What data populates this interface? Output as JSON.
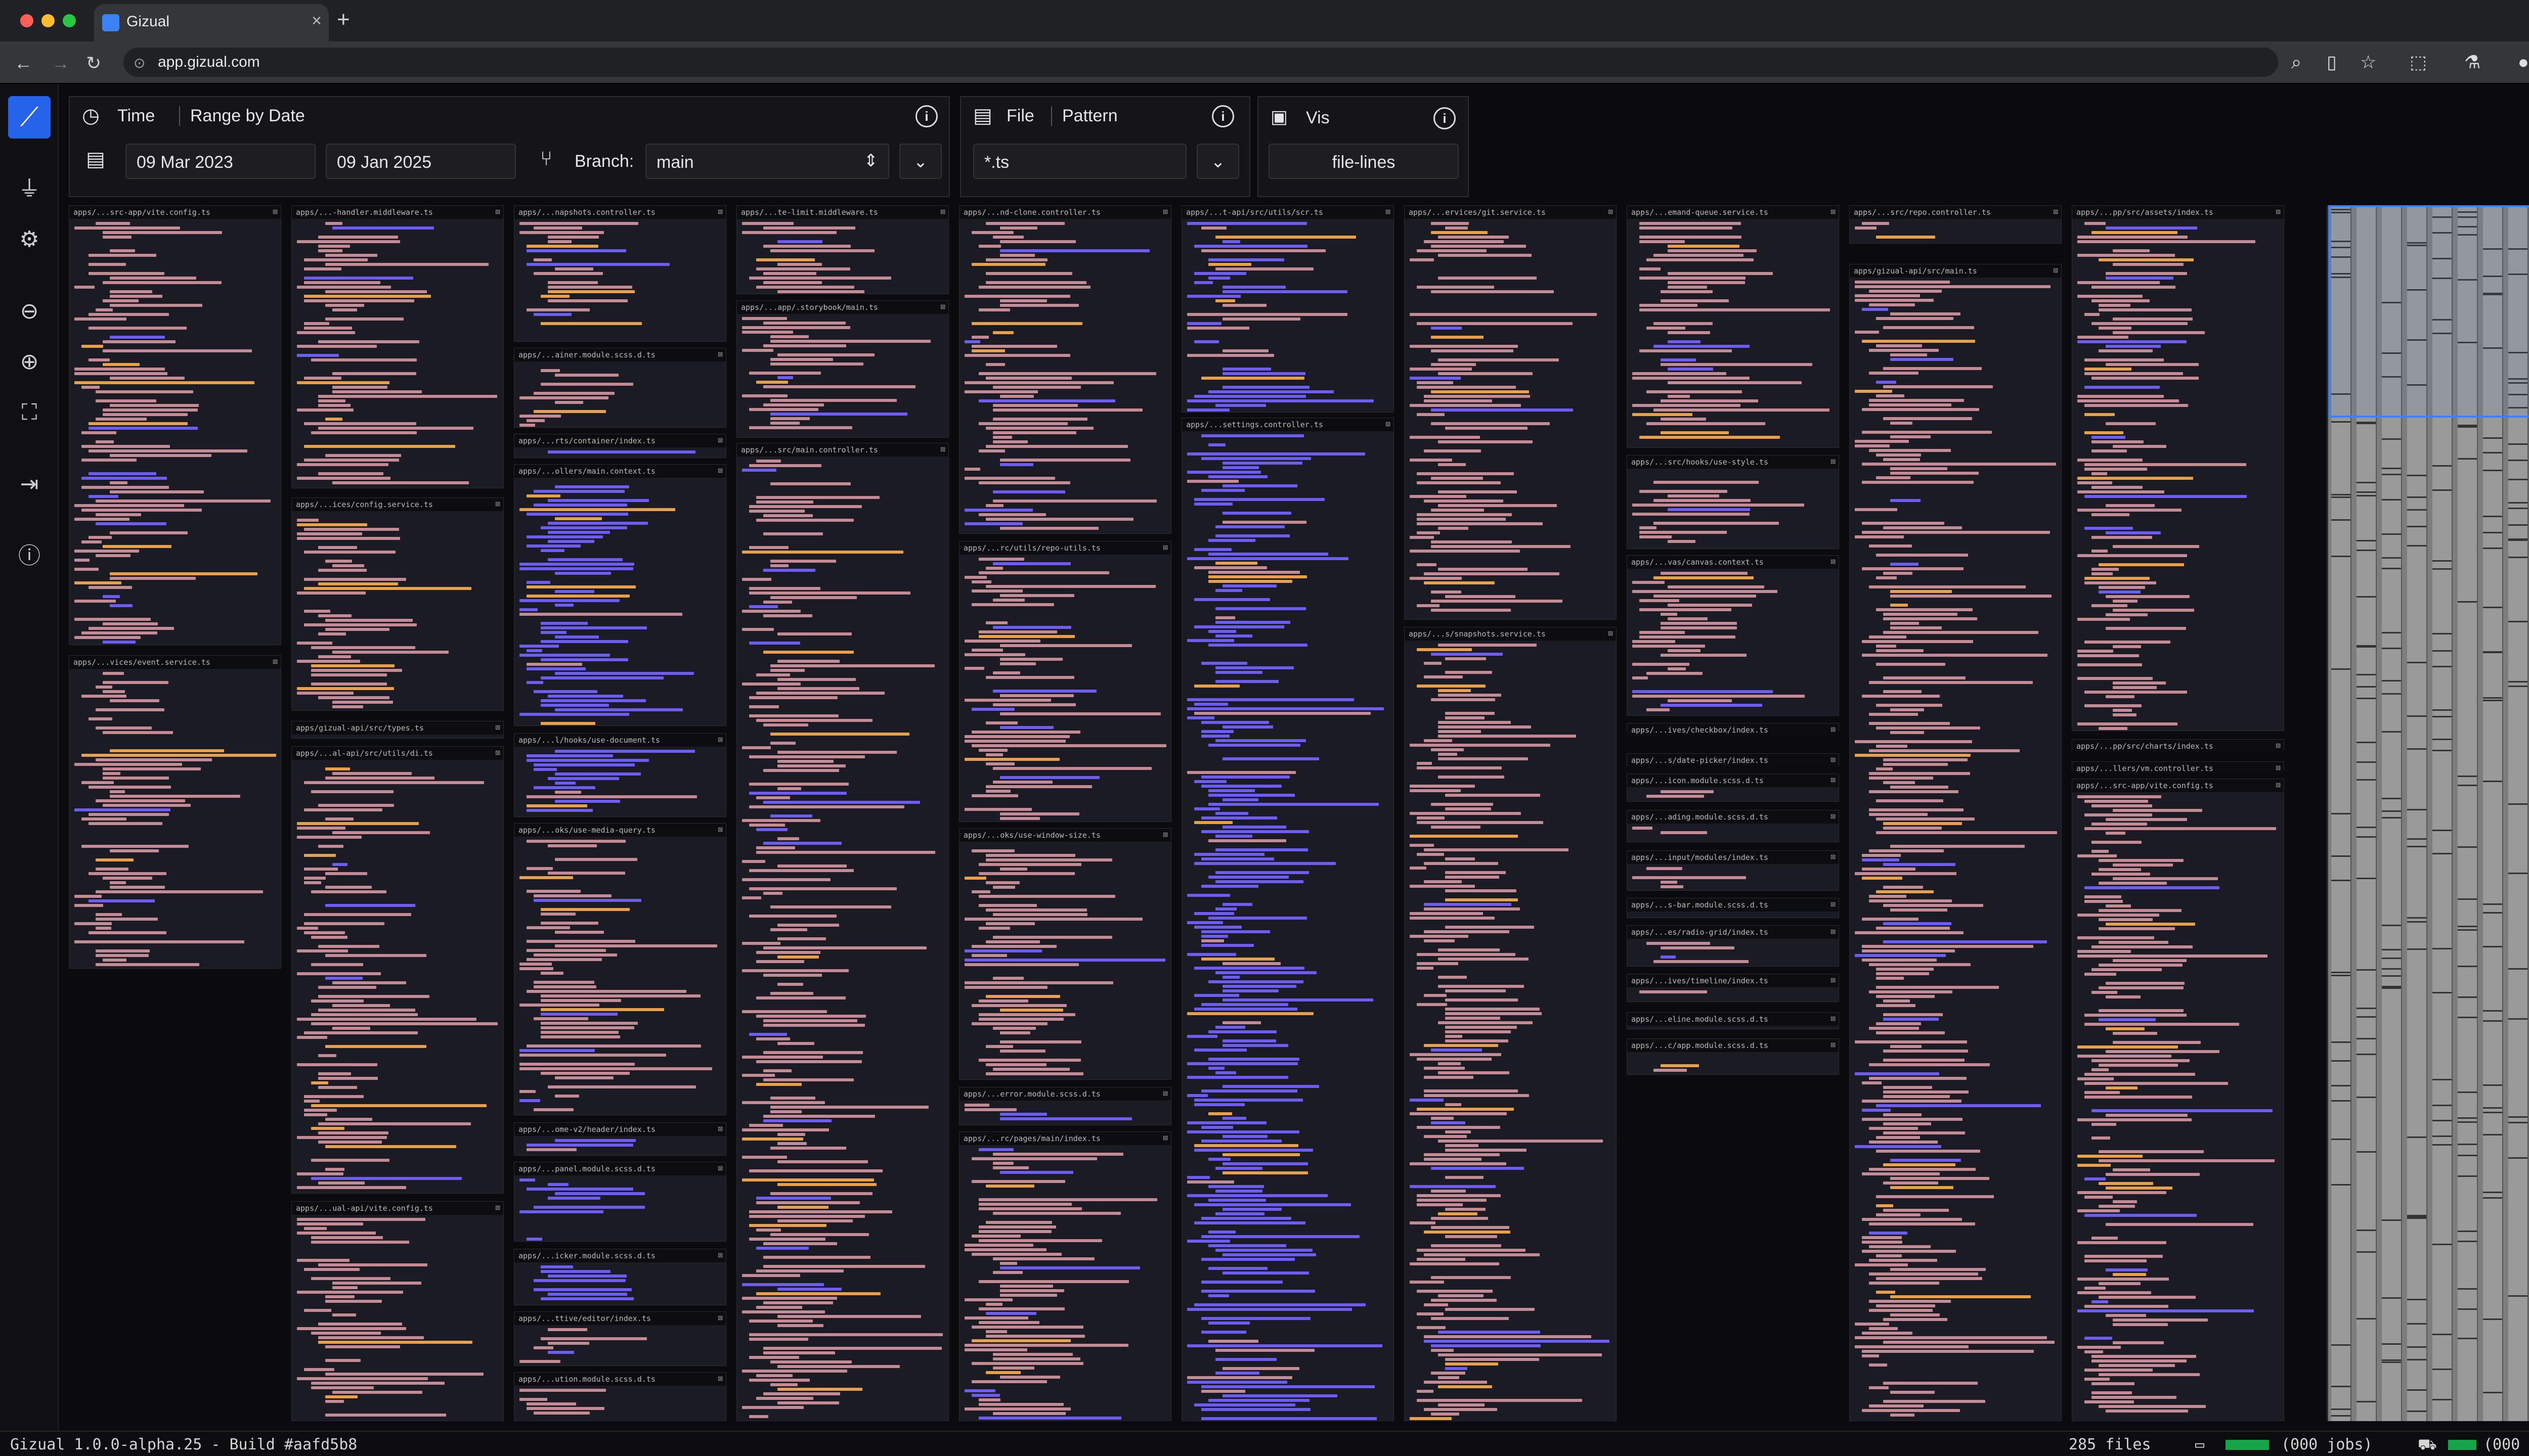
{
  "browser": {
    "tab_title": "Gizual",
    "url": "app.gizual.com"
  },
  "colors": {
    "accent": "#2563eb",
    "bg": "#0b0b0f",
    "card": "#1b1b23",
    "line_old": "#c48b94",
    "line_mid": "#6d5cf6",
    "line_new": "#e8a04a",
    "blue": "#3b3bf0"
  },
  "sidebar": {
    "items": [
      "filter-icon",
      "gear-icon",
      "zoom-out-icon",
      "zoom-in-icon",
      "fit-screen-icon",
      "export-icon",
      "info-icon"
    ]
  },
  "time_panel": {
    "label": "Time",
    "mode": "Range by Date",
    "start": "09 Mar 2023",
    "end": "09 Jan 2025",
    "branch_label": "Branch:",
    "branch": "main"
  },
  "file_panel": {
    "label": "File",
    "mode": "Pattern",
    "pattern": "*.ts"
  },
  "vis_panel": {
    "label": "Vis",
    "mode": "file-lines"
  },
  "files": [
    {
      "name": "apps/...src-app/vite.config.ts"
    },
    {
      "name": "apps/...vices/event.service.ts"
    },
    {
      "name": "apps/...-handler.middleware.ts"
    },
    {
      "name": "apps/...ices/config.service.ts"
    },
    {
      "name": "apps/gizual-api/src/types.ts"
    },
    {
      "name": "apps/...al-api/src/utils/di.ts"
    },
    {
      "name": "apps/...ual-api/vite.config.ts"
    },
    {
      "name": "apps/...napshots.controller.ts"
    },
    {
      "name": "apps/...ainer.module.scss.d.ts"
    },
    {
      "name": "apps/...rts/container/index.ts"
    },
    {
      "name": "apps/...ollers/main.context.ts"
    },
    {
      "name": "apps/...l/hooks/use-document.ts"
    },
    {
      "name": "apps/...oks/use-media-query.ts"
    },
    {
      "name": "apps/...ome-v2/header/index.ts"
    },
    {
      "name": "apps/...panel.module.scss.d.ts"
    },
    {
      "name": "apps/...icker.module.scss.d.ts"
    },
    {
      "name": "apps/...ttive/editor/index.ts"
    },
    {
      "name": "apps/...ution.module.scss.d.ts"
    },
    {
      "name": "apps/...te-limit.middleware.ts"
    },
    {
      "name": "apps/...app/.storybook/main.ts"
    },
    {
      "name": "apps/...src/main.controller.ts"
    },
    {
      "name": "apps/...nd-clone.controller.ts"
    },
    {
      "name": "apps/...rc/utils/repo-utils.ts"
    },
    {
      "name": "apps/...oks/use-window-size.ts"
    },
    {
      "name": "apps/...error.module.scss.d.ts"
    },
    {
      "name": "apps/...rc/pages/main/index.ts"
    },
    {
      "name": "apps/...t-api/src/utils/scr.ts"
    },
    {
      "name": "apps/...settings.controller.ts"
    },
    {
      "name": "apps/...ervices/git.service.ts"
    },
    {
      "name": "apps/...s/snapshots.service.ts"
    },
    {
      "name": "apps/...emand-queue.service.ts"
    },
    {
      "name": "apps/...src/hooks/use-style.ts"
    },
    {
      "name": "apps/...vas/canvas.context.ts"
    },
    {
      "name": "apps/...ives/checkbox/index.ts"
    },
    {
      "name": "apps/...s/date-picker/index.ts"
    },
    {
      "name": "apps/...icon.module.scss.d.ts"
    },
    {
      "name": "apps/...ading.module.scss.d.ts"
    },
    {
      "name": "apps/...input/modules/index.ts"
    },
    {
      "name": "apps/...s-bar.module.scss.d.ts"
    },
    {
      "name": "apps/...es/radio-grid/index.ts"
    },
    {
      "name": "apps/...ives/timeline/index.ts"
    },
    {
      "name": "apps/...eline.module.scss.d.ts"
    },
    {
      "name": "apps/...c/app.module.scss.d.ts"
    },
    {
      "name": "apps/...src/repo.controller.ts"
    },
    {
      "name": "apps/gizual-api/src/main.ts"
    },
    {
      "name": "apps/...pp/src/assets/index.ts"
    },
    {
      "name": "apps/...pp/src/charts/index.ts"
    },
    {
      "name": "apps/...llers/vm.controller.ts"
    }
  ],
  "status": {
    "version": "Gizual 1.0.0-alpha.25 - Build #aafd5b8",
    "files": "285 files",
    "jobs1": "(000 jobs)",
    "jobs2": "(000 jobs)"
  }
}
